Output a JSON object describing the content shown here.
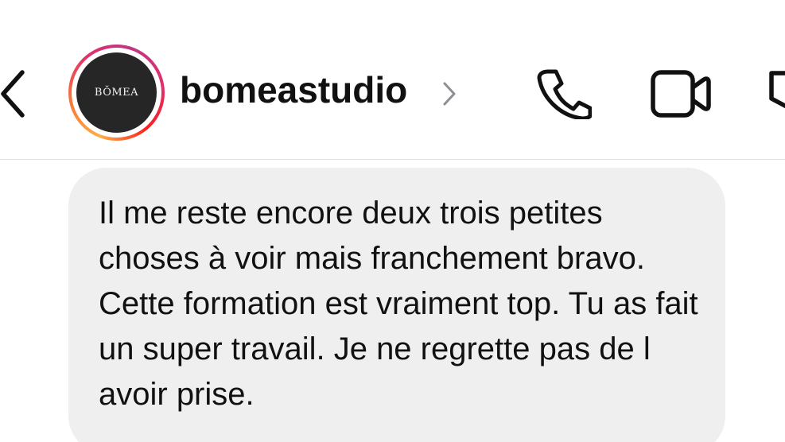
{
  "header": {
    "back_icon": "chevron-left-icon",
    "avatar_logo_text": "BŎMEA",
    "username": "bomeastudio",
    "profile_chevron_icon": "chevron-right-icon",
    "call_icon": "phone-icon",
    "video_icon": "video-camera-icon",
    "more_icon": "tag-icon"
  },
  "colors": {
    "background": "#ffffff",
    "bubble": "#efeff0",
    "text": "#111111",
    "avatar_bg": "#262626",
    "story_ring": [
      "#fcaf45",
      "#f77737",
      "#e1306c",
      "#c13584"
    ]
  },
  "message": {
    "text": "Il me reste encore deux trois petites choses à voir mais franchement bravo. Cette formation est vraiment top. Tu as fait un super travail. Je ne regrette pas de l avoir prise."
  }
}
